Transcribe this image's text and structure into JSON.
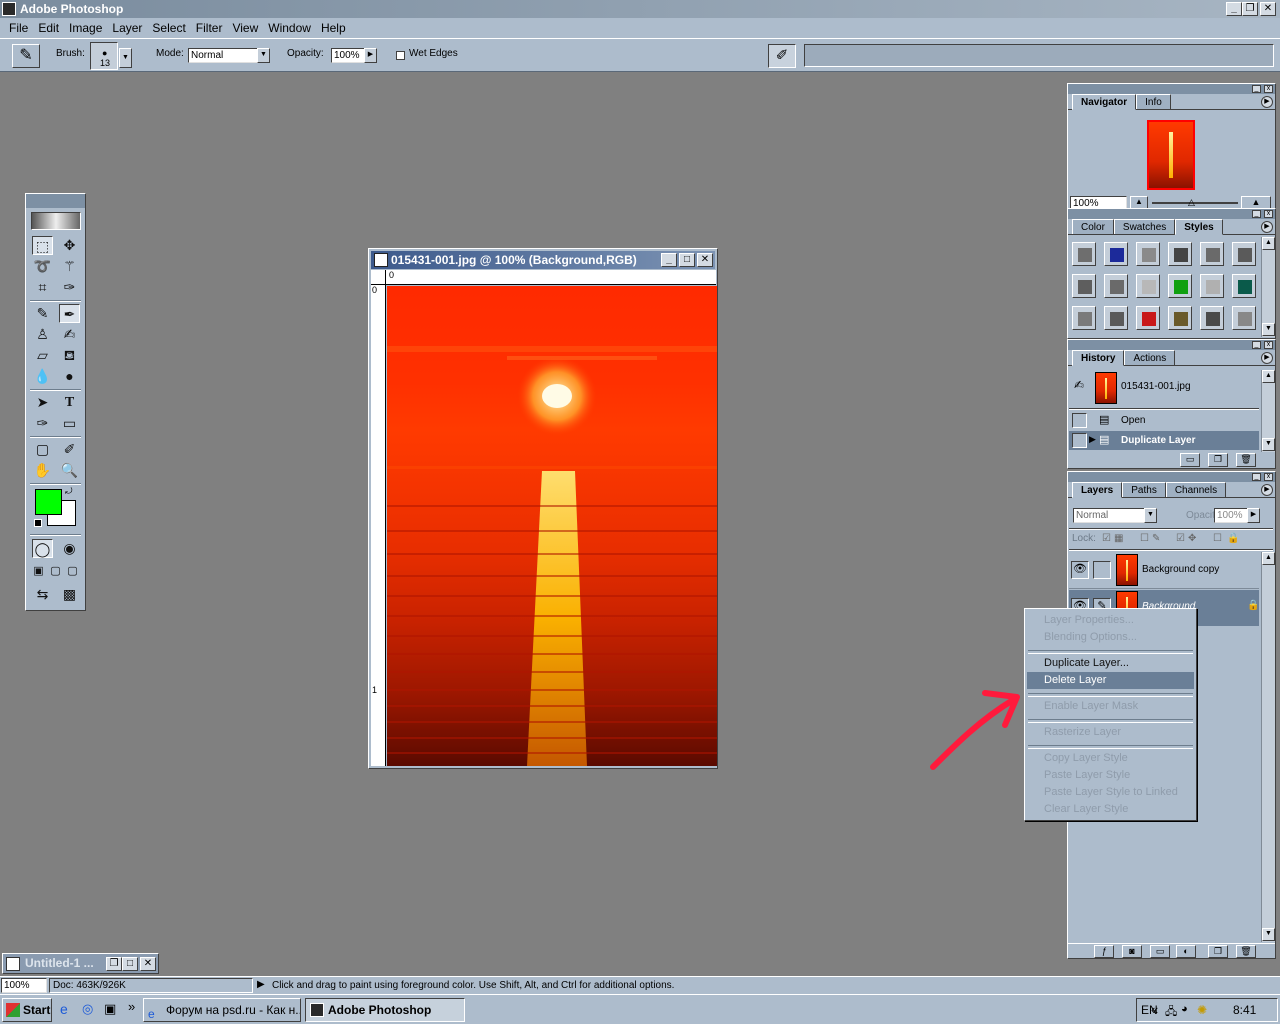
{
  "app": {
    "title": "Adobe Photoshop"
  },
  "menu": [
    "File",
    "Edit",
    "Image",
    "Layer",
    "Select",
    "Filter",
    "View",
    "Window",
    "Help"
  ],
  "options": {
    "brush_label": "Brush:",
    "brush_size": "13",
    "mode_label": "Mode:",
    "mode_value": "Normal",
    "opacity_label": "Opacity:",
    "opacity_value": "100%",
    "wet_edges_label": "Wet Edges",
    "wet_edges_checked": false
  },
  "document": {
    "title": "015431-001.jpg @ 100% (Background,RGB)",
    "ruler_top_origin": "0",
    "ruler_left_origin": "0",
    "ruler_left_mark": "1"
  },
  "navigator": {
    "tabs": [
      "Navigator",
      "Info"
    ],
    "zoom": "100%"
  },
  "styles_panel": {
    "tabs": [
      "Color",
      "Swatches",
      "Styles"
    ],
    "swatch_colors": [
      "#6e6e6e",
      "#1c2a9a",
      "#8a8a8a",
      "#444444",
      "#6a6a6a",
      "#5a5a5a",
      "#5e5e5e",
      "#6a6a6a",
      "#b8b8b8",
      "#10a010",
      "#b0b0b0",
      "#0a5a4a",
      "#7a7a7a",
      "#5a5a5a",
      "#c81818",
      "#6a5a2a",
      "#4a4a4a",
      "#888888"
    ]
  },
  "history": {
    "tabs": [
      "History",
      "Actions"
    ],
    "snapshot": "015431-001.jpg",
    "items": [
      "Open",
      "Duplicate Layer"
    ]
  },
  "layers": {
    "tabs": [
      "Layers",
      "Paths",
      "Channels"
    ],
    "blend_mode": "Normal",
    "opacity_label": "Opacity:",
    "opacity_value": "100%",
    "lock_label": "Lock:",
    "rows": [
      "Background copy",
      "Background"
    ]
  },
  "context_menu": {
    "groups": [
      [
        {
          "label": "Layer Properties...",
          "enabled": false
        },
        {
          "label": "Blending Options...",
          "enabled": false
        }
      ],
      [
        {
          "label": "Duplicate Layer...",
          "enabled": true
        },
        {
          "label": "Delete Layer",
          "enabled": true,
          "highlighted": true
        }
      ],
      [
        {
          "label": "Enable Layer Mask",
          "enabled": false
        }
      ],
      [
        {
          "label": "Rasterize Layer",
          "enabled": false
        }
      ],
      [
        {
          "label": "Copy Layer Style",
          "enabled": false
        },
        {
          "label": "Paste Layer Style",
          "enabled": false
        },
        {
          "label": "Paste Layer Style to Linked",
          "enabled": false
        },
        {
          "label": "Clear Layer Style",
          "enabled": false
        }
      ]
    ]
  },
  "minimized_window": {
    "title": "Untitled-1 ..."
  },
  "status": {
    "zoom": "100%",
    "doc": "Doc: 463K/926K",
    "hint": "Click and drag to paint using foreground color.  Use Shift, Alt, and Ctrl for additional options."
  },
  "taskbar": {
    "start": "Start",
    "chevron": "»",
    "tasks": [
      "Форум на psd.ru - Как н...",
      "Adobe Photoshop"
    ],
    "lang": "EN",
    "tray_chevron": "«",
    "time": "8:41"
  },
  "colors": {
    "foreground": "#00ff00",
    "background": "#ffffff",
    "annotation_arrow": "#ff1a3c"
  }
}
